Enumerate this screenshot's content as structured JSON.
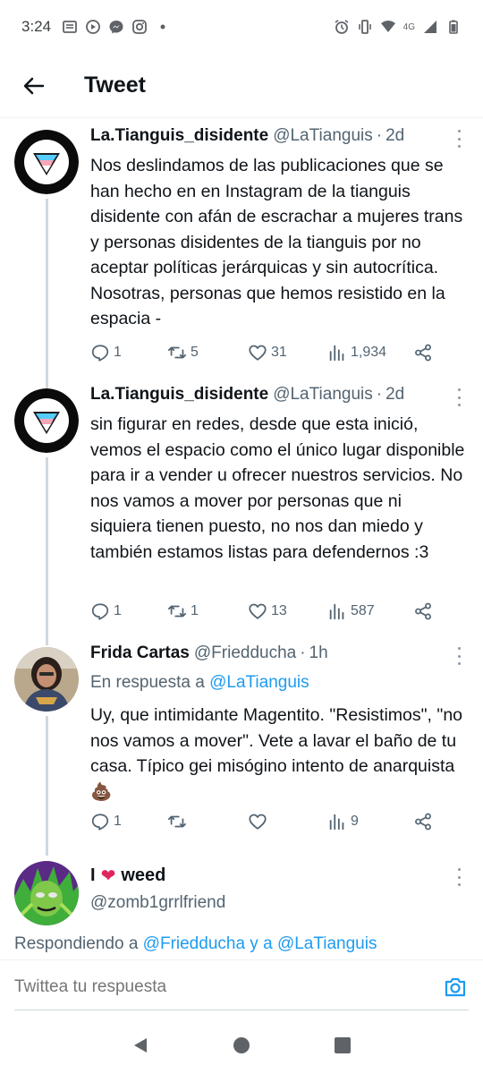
{
  "status_bar": {
    "time": "3:24",
    "network": "4G"
  },
  "header": {
    "title": "Tweet"
  },
  "tweets": [
    {
      "display_name": "La.Tianguis_disidente",
      "handle": "@LaTianguis",
      "time": "2d",
      "text": "Nos deslindamos de las publicaciones que se han hecho en en Instagram de la tianguis disidente con afán de escrachar a mujeres trans y personas disidentes de la tianguis por no aceptar políticas jerárquicas y sin autocrítica. Nosotras, personas que hemos resistido en la espacia -",
      "replies": "1",
      "retweets": "5",
      "likes": "31",
      "views": "1,934"
    },
    {
      "display_name": "La.Tianguis_disidente",
      "handle": "@LaTianguis",
      "time": "2d",
      "text": "sin figurar en redes, desde que esta inició, vemos el espacio como el único lugar disponible para ir a vender u ofrecer nuestros servicios. No nos vamos a mover por personas que ni siquiera tienen puesto, no nos dan miedo y también estamos listas para defendernos :3",
      "replies": "1",
      "retweets": "1",
      "likes": "13",
      "views": "587"
    },
    {
      "display_name": "Frida Cartas",
      "handle": "@Friedducha",
      "time": "1h",
      "reply_prefix": "En respuesta a",
      "reply_mention": "@LaTianguis",
      "text": "Uy, que intimidante Magentito. \"Resistimos\", \"no nos vamos a mover\". Vete a lavar el baño de tu casa. Típico gei misógino intento de anarquista 💩",
      "replies": "1",
      "retweets": "",
      "likes": "",
      "views": "9"
    }
  ],
  "reply_user": {
    "name_prefix": "I",
    "heart": "❤",
    "name_suffix": "weed",
    "handle": "@zomb1grrlfriend"
  },
  "replying": {
    "prefix": "Respondiendo a",
    "mention1": "@Friedducha",
    "connector": "y a",
    "mention2": "@LaTianguis"
  },
  "composer": {
    "placeholder": "Twittea tu respuesta"
  },
  "colors": {
    "accent": "#1d9bf0",
    "secondary_text": "#536471",
    "heart": "#e0245e"
  },
  "icons": [
    "back-arrow-icon",
    "more-icon",
    "reply-icon",
    "retweet-icon",
    "like-icon",
    "views-icon",
    "share-icon",
    "camera-icon",
    "nav-back-icon",
    "nav-home-icon",
    "nav-recents-icon"
  ]
}
